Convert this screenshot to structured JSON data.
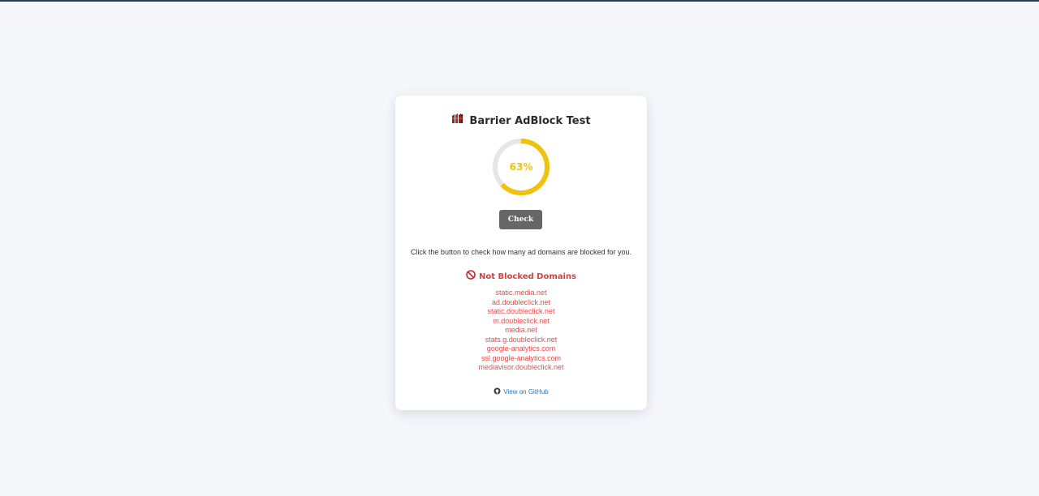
{
  "app": {
    "title": "Barrier AdBlock Test",
    "title_icon": "barrier-icon"
  },
  "progress": {
    "percent": 63,
    "label": "63%",
    "color": "#f0c20e",
    "track_color": "#e6e6e6"
  },
  "check_button": {
    "label": "Check"
  },
  "description": "Click the button to check how many ad domains are blocked for you.",
  "not_blocked": {
    "title": "Not Blocked Domains",
    "icon": "no-entry-icon",
    "color": "#e03b3b",
    "domains": [
      "static.media.net",
      "ad.doubleclick.net",
      "static.doubleclick.net",
      "m.doubleclick.net",
      "media.net",
      "stats.g.doubleclick.net",
      "google-analytics.com",
      "ssl.google-analytics.com",
      "mediavisor.doubleclick.net"
    ]
  },
  "github": {
    "label": "View on GitHub",
    "icon": "github-icon",
    "color": "#1a73c8"
  }
}
